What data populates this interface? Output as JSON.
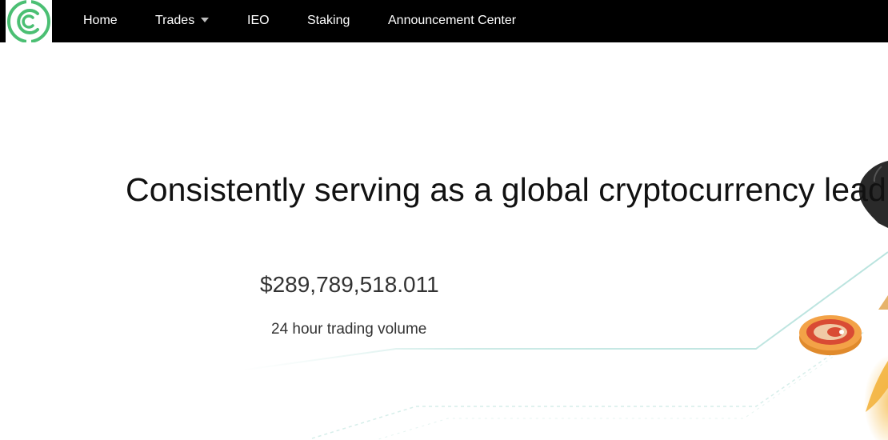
{
  "nav": {
    "logo": "C",
    "items": [
      {
        "label": "Home"
      },
      {
        "label": "Trades"
      },
      {
        "label": "IEO"
      },
      {
        "label": "Staking"
      },
      {
        "label": "Announcement Center"
      }
    ]
  },
  "hero": {
    "headline": "Consistently serving as a global cryptocurrency lead",
    "volume": "$289,789,518.011",
    "volume_label": "24 hour trading volume"
  },
  "colors": {
    "nav_bg": "#000000",
    "logo_green": "#4bbf73",
    "line_teal": "#bfe6e2",
    "coin_orange": "#e8923a",
    "coin_red": "#d94b34"
  }
}
